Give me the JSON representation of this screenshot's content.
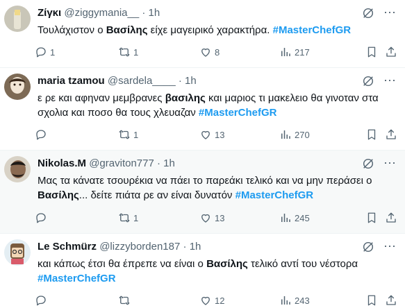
{
  "tweets": [
    {
      "name": "Ζίγκι",
      "handle": "@ziggymania__",
      "dot": "·",
      "time": "1h",
      "parts": [
        {
          "t": "Τουλάχιστον ο ",
          "s": "n"
        },
        {
          "t": "Βασίλης",
          "s": "b"
        },
        {
          "t": " είχε μαγειρικό χαρακτήρα. ",
          "s": "n"
        },
        {
          "t": "#MasterChefGR",
          "s": "h"
        }
      ],
      "replies": "1",
      "retweets": "1",
      "likes": "8",
      "views": "217"
    },
    {
      "name": "maria tzamou",
      "handle": "@sardela____",
      "dot": "·",
      "time": "1h",
      "parts": [
        {
          "t": "ε ρε και αφηναν μεμβρανες ",
          "s": "n"
        },
        {
          "t": "βασιλης",
          "s": "b"
        },
        {
          "t": " και μαριος τι μακελειο θα γινοταν στα σχολια και ποσο θα τους χλευαζαν ",
          "s": "n"
        },
        {
          "t": "#MasterChefGR",
          "s": "h"
        }
      ],
      "replies": "",
      "retweets": "1",
      "likes": "13",
      "views": "270"
    },
    {
      "name": "Nikolas.M",
      "handle": "@graviton777",
      "dot": "·",
      "time": "1h",
      "parts": [
        {
          "t": "Μας τα κάνατε τσουρέκια να πάει το παρεάκι τελικό και να μην περάσει ο ",
          "s": "n"
        },
        {
          "t": "Βασίλης",
          "s": "b"
        },
        {
          "t": "... δείτε πιάτα ρε αν είναι δυνατόν ",
          "s": "n"
        },
        {
          "t": "#MasterChefGR",
          "s": "h"
        }
      ],
      "replies": "",
      "retweets": "1",
      "likes": "13",
      "views": "245"
    },
    {
      "name": "Le Schmürz",
      "handle": "@lizzyborden187",
      "dot": "·",
      "time": "1h",
      "parts": [
        {
          "t": "και κάπως έτσι θα έπρεπε να είναι ο ",
          "s": "n"
        },
        {
          "t": "Βασίλης",
          "s": "b"
        },
        {
          "t": " τελικό αντί του νέστορα ",
          "s": "n"
        },
        {
          "t": "#MasterChefGR",
          "s": "h"
        }
      ],
      "replies": "",
      "retweets": "",
      "likes": "12",
      "views": "243"
    }
  ],
  "icons": {
    "reply": "reply-icon",
    "retweet": "retweet-icon",
    "like": "heart-icon",
    "views": "views-icon",
    "bookmark": "bookmark-icon",
    "share": "share-icon",
    "grok": "grok-icon",
    "more": "more-icon"
  },
  "colors": {
    "hashtag": "#1d9bf0",
    "muted": "#536471",
    "text": "#0f1419",
    "highlight_bg": "#f7f9f9"
  }
}
